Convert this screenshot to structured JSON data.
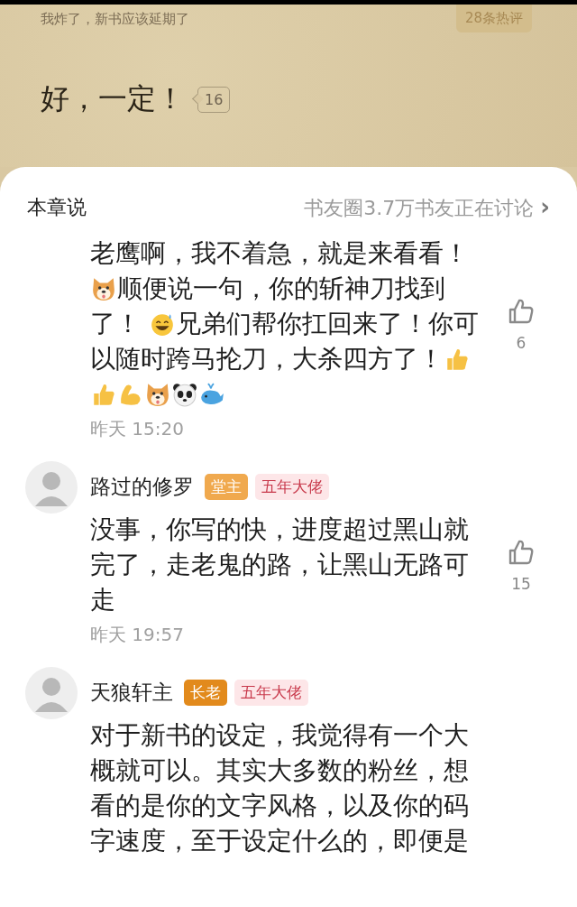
{
  "reader": {
    "header_text": "我炸了，新书应该延期了",
    "hot_badge": "28条热评",
    "paragraph": "好，一定！",
    "paragraph_comment_count": "16"
  },
  "sheet": {
    "title": "本章说",
    "discussion_link": "书友圈3.7万书友正在讨论",
    "link_arrow": "›"
  },
  "comments": [
    {
      "lines": [
        [
          {
            "kind": "text",
            "text": "老鹰啊，我不着急，就是来看看！"
          }
        ],
        [
          {
            "kind": "dog"
          },
          {
            "kind": "text",
            "text": "顺便说一句，你的斩神刀找到"
          }
        ],
        [
          {
            "kind": "text",
            "text": "了！ "
          },
          {
            "kind": "grin"
          },
          {
            "kind": "text",
            "text": "兄弟们帮你扛回来了！你可"
          }
        ],
        [
          {
            "kind": "text",
            "text": "以随时跨马抡刀，大杀四方了！"
          },
          {
            "kind": "thumb"
          }
        ],
        [
          {
            "kind": "thumb"
          },
          {
            "kind": "muscle"
          },
          {
            "kind": "dog"
          },
          {
            "kind": "panda"
          },
          {
            "kind": "whale"
          }
        ]
      ],
      "time": "昨天 15:20",
      "likes": "6",
      "liked": false
    },
    {
      "author": "路过的修罗",
      "badges": [
        {
          "text": "堂主",
          "color": "#f0a94e"
        },
        {
          "text": "五年大佬",
          "color": "#fde6e8"
        }
      ],
      "lines": [
        [
          {
            "kind": "text",
            "text": "没事，你写的快，进度超过黑山就完了，走老鬼的路，让黑山无路可走"
          }
        ]
      ],
      "time": "昨天 19:57",
      "likes": "15",
      "liked": false
    },
    {
      "author": "天狼轩主",
      "badges": [
        {
          "text": "长老",
          "color": "#e28a1c"
        },
        {
          "text": "五年大佬",
          "color": "#fde6e8"
        }
      ],
      "lines": [
        [
          {
            "kind": "text",
            "text": "对于新书的设定，我觉得有一个大概就可以。其实大多数的粉丝，想看的是你的文字风格，以及你的码字速度，至于设定什么的，即便是"
          }
        ]
      ]
    }
  ]
}
